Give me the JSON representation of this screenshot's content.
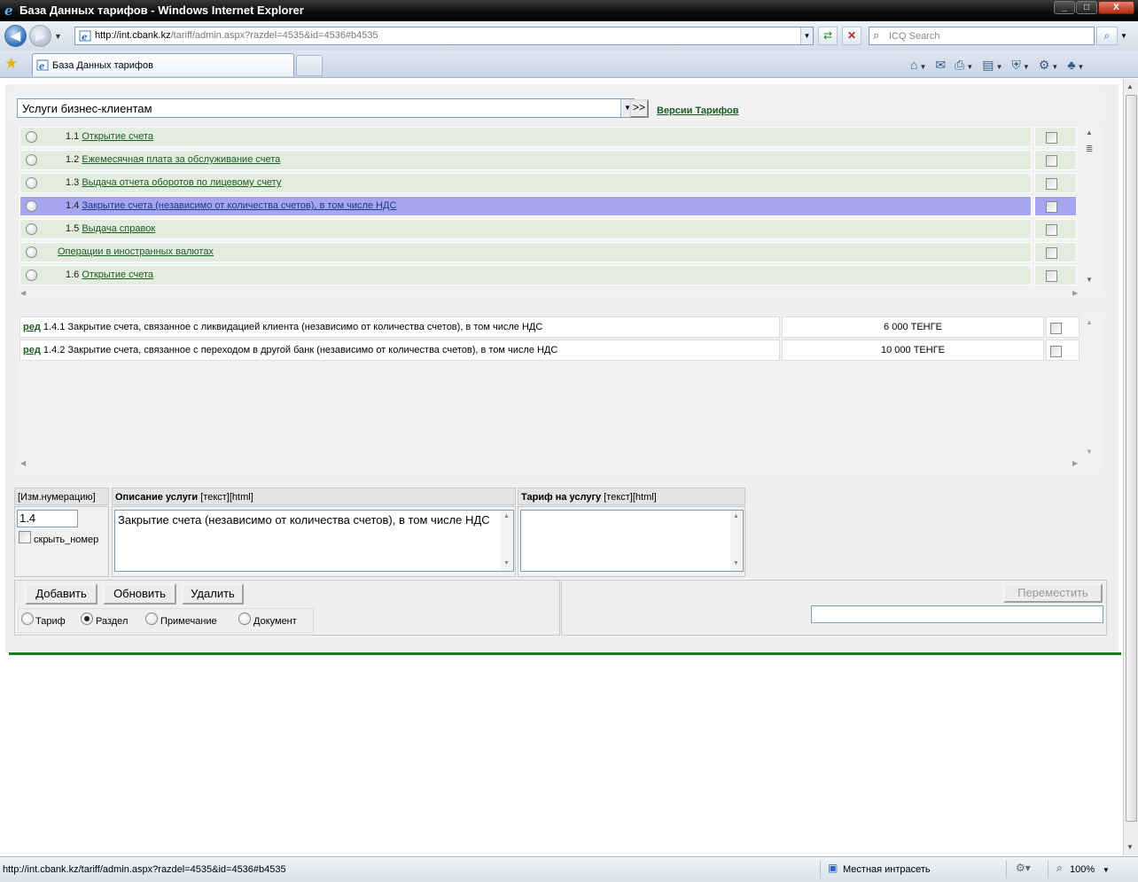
{
  "window": {
    "title": "База Данных тарифов - Windows Internet Explorer",
    "controls": [
      "_",
      "□",
      "X"
    ]
  },
  "browser": {
    "address": {
      "host": "http://int.cbank.kz",
      "path": "/tariff/admin.aspx?razdel=4535&id=4536#b4535"
    },
    "search_placeholder": "ICQ Search",
    "tab_title": "База Данных тарифов",
    "status_url": "http://int.cbank.kz/tariff/admin.aspx?razdel=4535&id=4536#b4535",
    "status_zone": "Местная интрасеть",
    "zoom": "100%",
    "icons": [
      "back-icon",
      "forward-icon",
      "refresh-icon",
      "stop-icon",
      "home-icon",
      "feeds-icon",
      "print-icon",
      "page-icon",
      "safety-icon",
      "tools-icon",
      "research-icon"
    ]
  },
  "page": {
    "category_select": "Услуги бизнес-клиентам",
    "go_button": ">>",
    "versions_link": "Версии Тарифов",
    "sections": [
      {
        "num": "1.1",
        "label": "Открытие счета",
        "selected": false
      },
      {
        "num": "1.2",
        "label": "Ежемесячная плата за обслуживание счета",
        "selected": false
      },
      {
        "num": "1.3",
        "label": "Выдача отчета оборотов по лицевому счету",
        "selected": false
      },
      {
        "num": "1.4",
        "label": "Закрытие счета (независимо от количества счетов), в том числе НДС",
        "selected": true
      },
      {
        "num": "1.5",
        "label": "Выдача справок",
        "selected": false
      },
      {
        "num": "",
        "label": "Операции в иностранных валютах",
        "selected": false
      },
      {
        "num": "1.6",
        "label": "Открытие счета",
        "selected": false
      }
    ],
    "tariffs": [
      {
        "edit": "ред",
        "text": "1.4.1 Закрытие счета, связанное с ликвидацией клиента (независимо от количества счетов), в том числе НДС",
        "price": "6 000 ТЕНГЕ"
      },
      {
        "edit": "ред",
        "text": "1.4.2 Закрытие счета, связанное с переходом в другой банк (независимо от количества счетов), в том числе НДС",
        "price": "10 000 ТЕНГЕ"
      }
    ],
    "editor": {
      "renumber_header": "[Изм.нумерацию]",
      "desc_header_bold": "Описание услуги",
      "desc_header_links": " [текст][html]",
      "tariff_header_bold": "Тариф на услугу",
      "tariff_header_links": " [текст][html]",
      "number_value": "1.4",
      "hide_number_label": "скрыть_номер",
      "description_value": "Закрытие счета (независимо от количества счетов), в том числе НДС",
      "tariff_value": ""
    },
    "buttons": {
      "add": "Добавить",
      "update": "Обновить",
      "delete": "Удалить",
      "move": "Переместить"
    },
    "types": [
      {
        "label": "Тариф",
        "checked": false
      },
      {
        "label": "Раздел",
        "checked": true
      },
      {
        "label": "Примечание",
        "checked": false
      },
      {
        "label": "Документ",
        "checked": false
      }
    ],
    "accent_color": "#1b7a1b",
    "selected_row_color": "#a6a6f0",
    "row_color": "#e4ecdf"
  }
}
